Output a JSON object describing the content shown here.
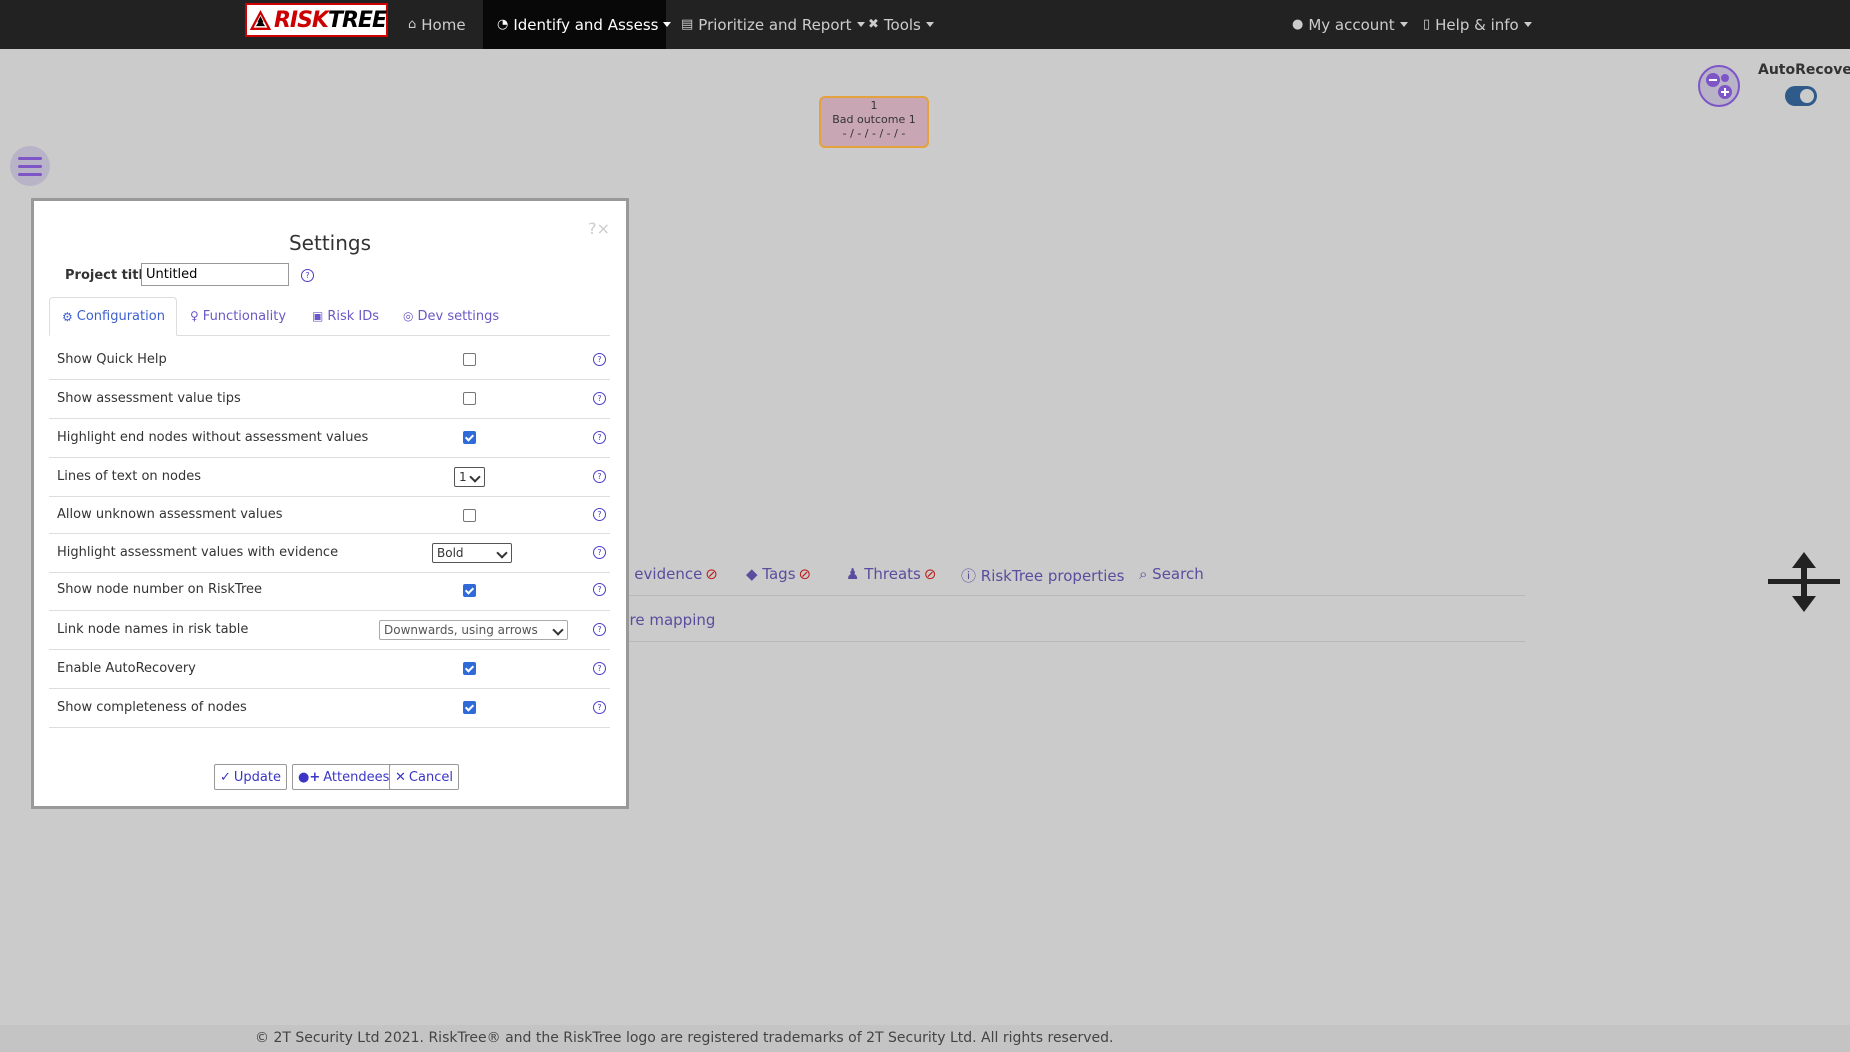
{
  "navbar": {
    "logo_text": "RiskTree",
    "items": [
      {
        "label": "Home",
        "icon": "home-icon"
      },
      {
        "label": "Identify and Assess",
        "icon": "gauge-icon",
        "active": true
      },
      {
        "label": "Prioritize and Report",
        "icon": "book-icon"
      },
      {
        "label": "Tools",
        "icon": "tools-icon"
      },
      {
        "label": "My account",
        "icon": "user-icon"
      },
      {
        "label": "Help & info",
        "icon": "info-icon"
      }
    ]
  },
  "node": {
    "number": "1",
    "name": "Bad outcome 1",
    "values": "- / - / - / - / -"
  },
  "autorecover": {
    "label": "AutoRecover",
    "enabled": true
  },
  "background_tabs": {
    "items": [
      {
        "label": "d evidence",
        "icon": "ban-icon"
      },
      {
        "label": "Tags",
        "icon": "tags-icon"
      },
      {
        "label": "Threats",
        "icon": "threats-icon"
      },
      {
        "label": "RiskTree properties",
        "icon": "info-circle-icon"
      },
      {
        "label": "Search",
        "icon": "search-icon"
      }
    ],
    "row2_label": "ure mapping"
  },
  "dialog": {
    "title": "Settings",
    "close": "?×",
    "project_title_label": "Project title",
    "project_title_value": "Untitled",
    "tabs": [
      {
        "label": "Configuration",
        "icon": "cogs-icon",
        "active": true
      },
      {
        "label": "Functionality",
        "icon": "lightbulb-icon"
      },
      {
        "label": "Risk IDs",
        "icon": "id-card-icon"
      },
      {
        "label": "Dev settings",
        "icon": "palette-icon"
      }
    ],
    "rows": [
      {
        "label": "Show Quick Help",
        "type": "checkbox",
        "checked": false
      },
      {
        "label": "Show assessment value tips",
        "type": "checkbox",
        "checked": false
      },
      {
        "label": "Highlight end nodes without assessment values",
        "type": "checkbox",
        "checked": true
      },
      {
        "label": "Lines of text on nodes",
        "type": "select",
        "value": "1"
      },
      {
        "label": "Allow unknown assessment values",
        "type": "checkbox",
        "checked": false
      },
      {
        "label": "Highlight assessment values with evidence",
        "type": "select",
        "value": "Bold"
      },
      {
        "label": "Show node number on RiskTree",
        "type": "checkbox",
        "checked": true
      },
      {
        "label": "Link node names in risk table",
        "type": "select",
        "value": "Downwards, using arrows"
      },
      {
        "label": "Enable AutoRecovery",
        "type": "checkbox",
        "checked": true
      },
      {
        "label": "Show completeness of nodes",
        "type": "checkbox",
        "checked": true
      }
    ],
    "buttons": {
      "update": "Update",
      "attendees": "Attendees",
      "cancel": "Cancel"
    }
  },
  "footer": {
    "text": "© 2T Security Ltd 2021. RiskTree® and the RiskTree logo are registered trademarks of 2T Security Ltd. All rights reserved."
  },
  "colors": {
    "navbar": "#222222",
    "accent": "#3b35c6",
    "node_fill": "#c9a6b4",
    "node_border": "#e4a23c"
  }
}
